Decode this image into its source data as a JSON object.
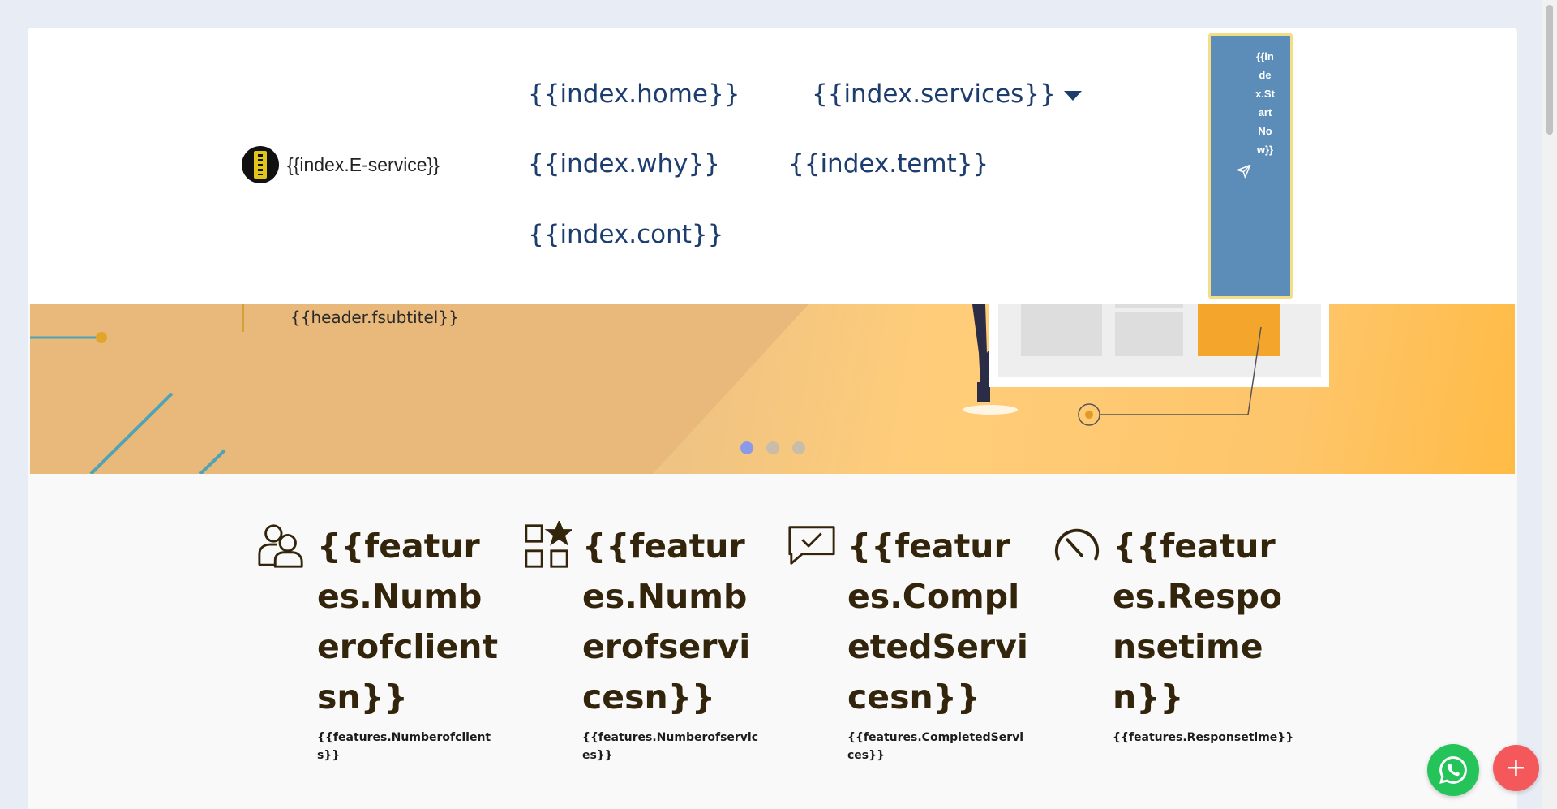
{
  "nav": {
    "brand_text": "{{index.E-service}}",
    "home": "{{index.home}}",
    "services": "{{index.services}}",
    "why": "{{index.why}}",
    "temt": "{{index.temt}}",
    "cont": "{{index.cont}}",
    "start_now": "{{index.StartNow}}"
  },
  "hero": {
    "subtitle": "{{header.fsubtitel}}",
    "slide_count": 3,
    "active_slide": 1
  },
  "features": [
    {
      "icon": "users-icon",
      "number": "{{features.Numberofclientsn}}",
      "label": "{{features.Numberofclients}}"
    },
    {
      "icon": "services-grid-icon",
      "number": "{{features.Numberofservicesn}}",
      "label": "{{features.Numberofservices}}"
    },
    {
      "icon": "chat-check-icon",
      "number": "{{features.CompletedServicesn}}",
      "label": "{{features.CompletedServices}}"
    },
    {
      "icon": "speedometer-icon",
      "number": "{{features.Responsetimen}}",
      "label": "{{features.Responsetime}}"
    }
  ],
  "floating": {
    "whatsapp_icon": "whatsapp-icon",
    "plus_label": "+"
  },
  "colors": {
    "nav_link": "#1c3d6e",
    "start_button": "#5b8db8",
    "whatsapp": "#25c45b",
    "plus": "#f5585a"
  }
}
